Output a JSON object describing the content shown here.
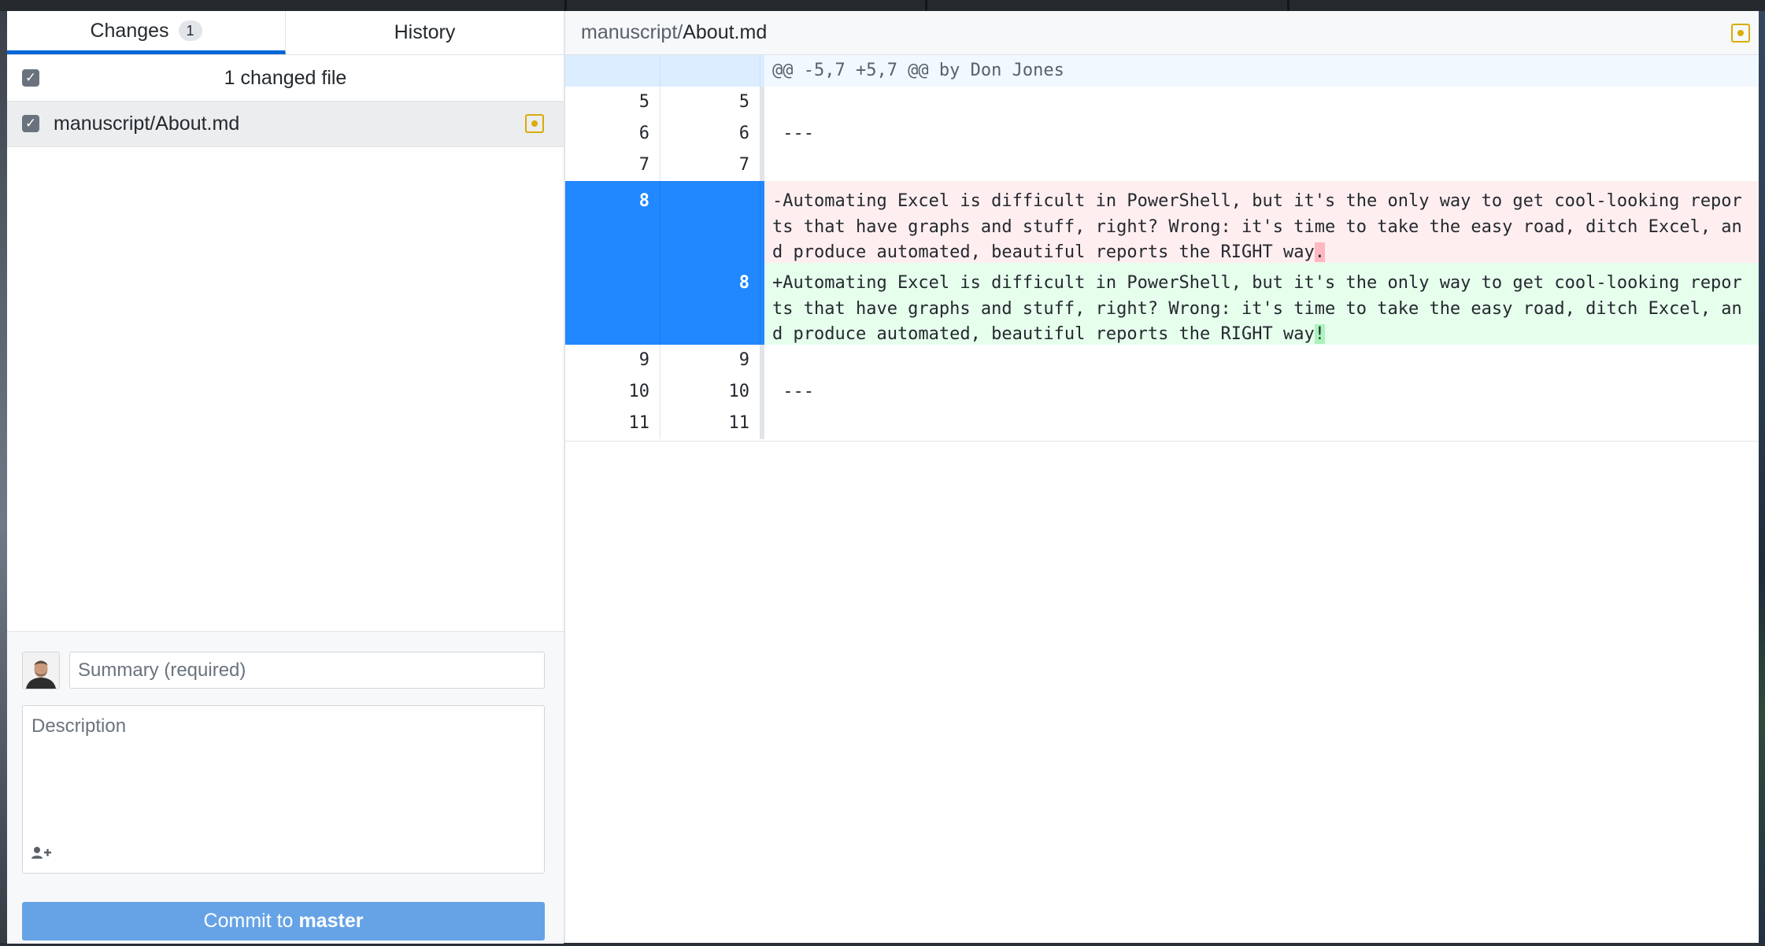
{
  "sidebar": {
    "tabs": [
      {
        "label": "Changes",
        "count": "1"
      },
      {
        "label": "History"
      }
    ],
    "changed_files_label": "1 changed file",
    "files": [
      {
        "path": "manuscript/About.md",
        "status": "modified"
      }
    ]
  },
  "commit": {
    "summary_placeholder": "Summary (required)",
    "description_placeholder": "Description",
    "button_prefix": "Commit to",
    "branch": "master"
  },
  "diff": {
    "path_dir": "manuscript/",
    "path_file": "About.md",
    "hunk_header": "@@ -5,7 +5,7 @@ by Don Jones",
    "lines": [
      {
        "old": "5",
        "new": "5",
        "text": ""
      },
      {
        "old": "6",
        "new": "6",
        "text": " ---"
      },
      {
        "old": "7",
        "new": "7",
        "text": ""
      },
      {
        "old": "8",
        "new": "",
        "type": "del",
        "text": "-Automating Excel is difficult in PowerShell, but it's the only way to get cool-looking reports that have graphs and stuff, right? Wrong: it's time to take the easy road, ditch Excel, and produce automated, beautiful reports the RIGHT way",
        "highlight": "."
      },
      {
        "old": "",
        "new": "8",
        "type": "add",
        "text": "+Automating Excel is difficult in PowerShell, but it's the only way to get cool-looking reports that have graphs and stuff, right? Wrong: it's time to take the easy road, ditch Excel, and produce automated, beautiful reports the RIGHT way",
        "highlight": "!"
      },
      {
        "old": "9",
        "new": "9",
        "text": ""
      },
      {
        "old": "10",
        "new": "10",
        "text": " ---"
      },
      {
        "old": "11",
        "new": "11",
        "text": ""
      }
    ]
  },
  "colors": {
    "accent": "#0366d6",
    "selected_gutter": "#2188ff",
    "deletion_bg": "#ffeef0",
    "addition_bg": "#e6ffed",
    "modified_icon": "#dbab09",
    "commit_button": "#66a3e6"
  },
  "icons": {
    "modified": "file-modified-icon",
    "checkbox": "checkmark-icon",
    "coauthor": "add-coauthor-icon",
    "avatar": "user-avatar"
  }
}
